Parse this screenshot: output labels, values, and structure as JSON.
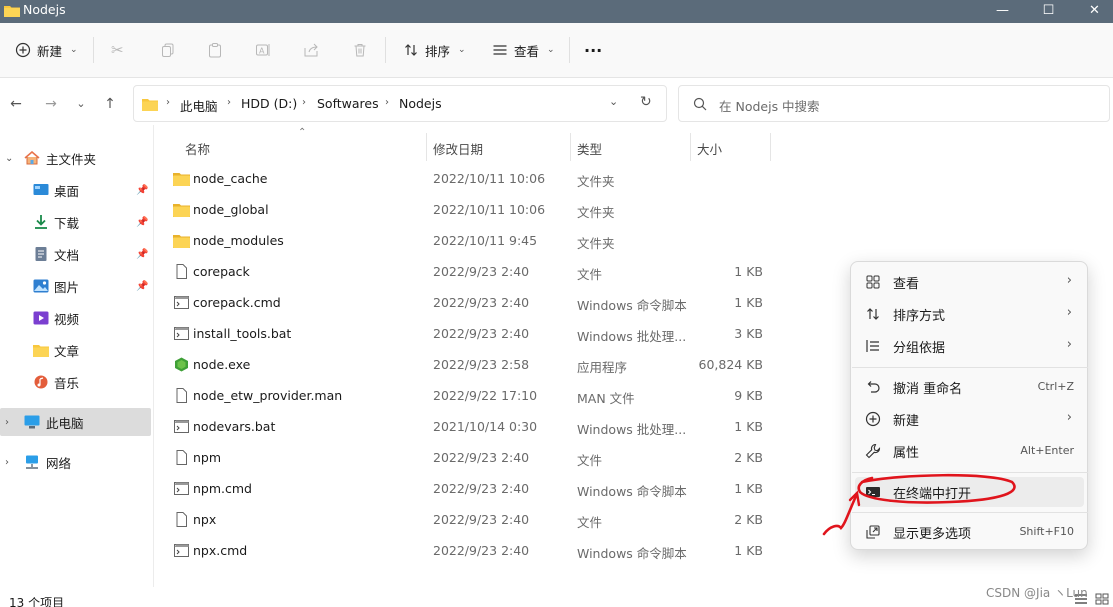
{
  "window": {
    "title": "Nodejs",
    "controls": [
      "—",
      "☐",
      "✕"
    ]
  },
  "toolbar": {
    "new_label": "新建",
    "sort_label": "排序",
    "view_label": "查看",
    "more_label": "···"
  },
  "address": {
    "crumbs": [
      "此电脑",
      "HDD (D:)",
      "Softwares",
      "Nodejs"
    ]
  },
  "search": {
    "placeholder": "在 Nodejs 中搜索"
  },
  "sidebar": {
    "items": [
      {
        "label": "主文件夹",
        "icon": "home-icon"
      },
      {
        "label": "桌面",
        "icon": "desktop-icon",
        "pinned": true
      },
      {
        "label": "下载",
        "icon": "download-icon",
        "pinned": true
      },
      {
        "label": "文档",
        "icon": "document-icon",
        "pinned": true
      },
      {
        "label": "图片",
        "icon": "picture-icon",
        "pinned": true
      },
      {
        "label": "视频",
        "icon": "video-icon"
      },
      {
        "label": "文章",
        "icon": "folder-icon"
      },
      {
        "label": "音乐",
        "icon": "music-icon"
      },
      {
        "label": "此电脑",
        "icon": "computer-icon",
        "selected": true
      },
      {
        "label": "网络",
        "icon": "network-icon"
      }
    ]
  },
  "columns": {
    "name": "名称",
    "date": "修改日期",
    "type": "类型",
    "size": "大小"
  },
  "files": [
    {
      "name": "node_cache",
      "date": "2022/10/11 10:06",
      "type": "文件夹",
      "size": "",
      "icon": "folder-icon"
    },
    {
      "name": "node_global",
      "date": "2022/10/11 10:06",
      "type": "文件夹",
      "size": "",
      "icon": "folder-icon"
    },
    {
      "name": "node_modules",
      "date": "2022/10/11 9:45",
      "type": "文件夹",
      "size": "",
      "icon": "folder-icon"
    },
    {
      "name": "corepack",
      "date": "2022/9/23 2:40",
      "type": "文件",
      "size": "1 KB",
      "icon": "file-icon"
    },
    {
      "name": "corepack.cmd",
      "date": "2022/9/23 2:40",
      "type": "Windows 命令脚本",
      "size": "1 KB",
      "icon": "script-icon"
    },
    {
      "name": "install_tools.bat",
      "date": "2022/9/23 2:40",
      "type": "Windows 批处理...",
      "size": "3 KB",
      "icon": "script-icon"
    },
    {
      "name": "node.exe",
      "date": "2022/9/23 2:58",
      "type": "应用程序",
      "size": "60,824 KB",
      "icon": "node-exe-icon"
    },
    {
      "name": "node_etw_provider.man",
      "date": "2022/9/22 17:10",
      "type": "MAN 文件",
      "size": "9 KB",
      "icon": "file-icon"
    },
    {
      "name": "nodevars.bat",
      "date": "2021/10/14 0:30",
      "type": "Windows 批处理...",
      "size": "1 KB",
      "icon": "script-icon"
    },
    {
      "name": "npm",
      "date": "2022/9/23 2:40",
      "type": "文件",
      "size": "2 KB",
      "icon": "file-icon"
    },
    {
      "name": "npm.cmd",
      "date": "2022/9/23 2:40",
      "type": "Windows 命令脚本",
      "size": "1 KB",
      "icon": "script-icon"
    },
    {
      "name": "npx",
      "date": "2022/9/23 2:40",
      "type": "文件",
      "size": "2 KB",
      "icon": "file-icon"
    },
    {
      "name": "npx.cmd",
      "date": "2022/9/23 2:40",
      "type": "Windows 命令脚本",
      "size": "1 KB",
      "icon": "script-icon"
    }
  ],
  "status": {
    "count": "13 个项目"
  },
  "context_menu": {
    "items": [
      {
        "label": "查看",
        "icon": "grid-icon",
        "arrow": "›",
        "shortcut": ""
      },
      {
        "label": "排序方式",
        "icon": "sort-icon",
        "arrow": "›",
        "shortcut": ""
      },
      {
        "label": "分组依据",
        "icon": "group-icon",
        "arrow": "›",
        "shortcut": ""
      },
      {
        "label": "撤消 重命名",
        "icon": "undo-icon",
        "arrow": "",
        "shortcut": "Ctrl+Z"
      },
      {
        "label": "新建",
        "icon": "plus-circle-icon",
        "arrow": "›",
        "shortcut": ""
      },
      {
        "label": "属性",
        "icon": "wrench-icon",
        "arrow": "",
        "shortcut": "Alt+Enter"
      },
      {
        "label": "在终端中打开",
        "icon": "terminal-icon",
        "arrow": "",
        "shortcut": ""
      },
      {
        "label": "显示更多选项",
        "icon": "share-icon",
        "arrow": "",
        "shortcut": "Shift+F10"
      }
    ]
  },
  "watermark": "CSDN @Jia ヽLun",
  "colors": {
    "folder": "#f8c73e",
    "annotation": "#e0141c",
    "titlebar": "#5b6b7a"
  }
}
